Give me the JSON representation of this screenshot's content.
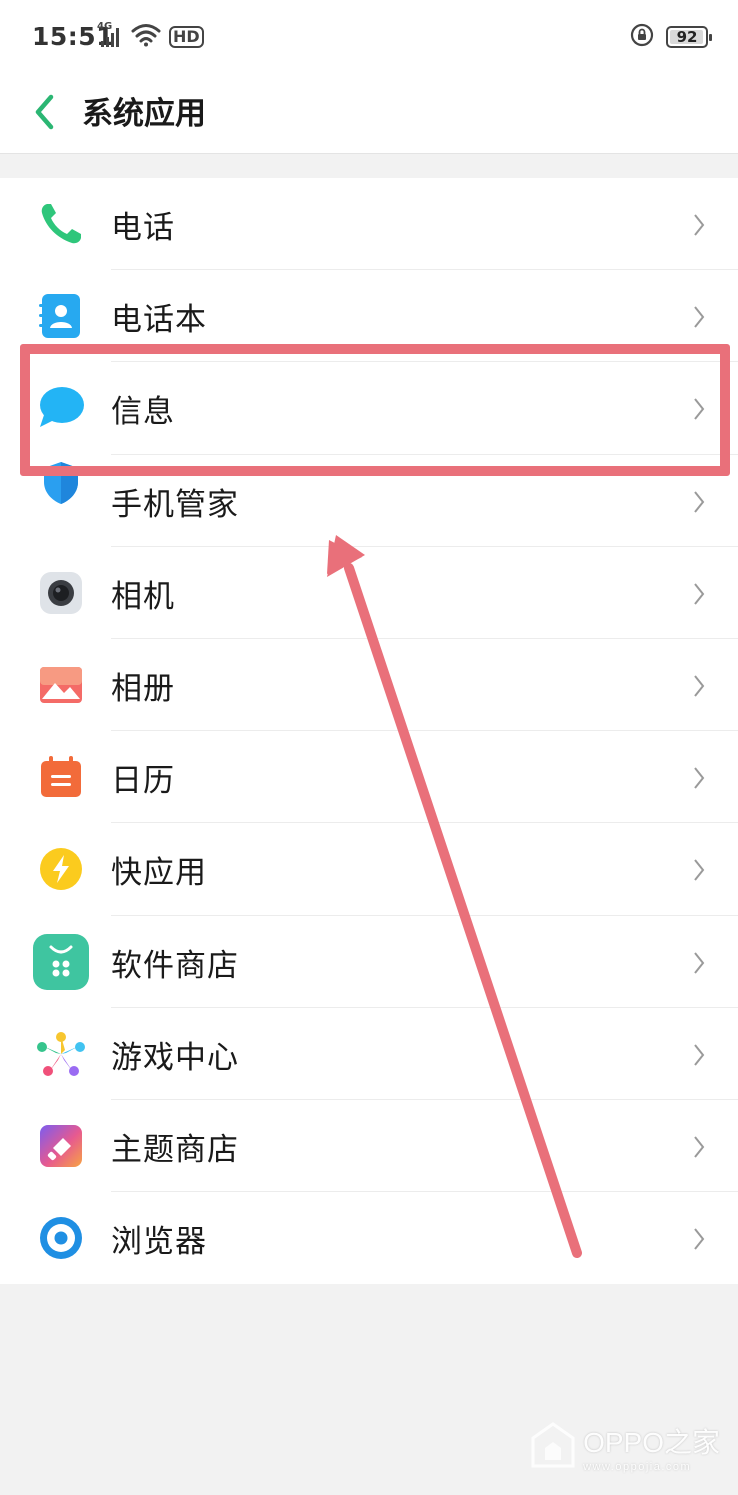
{
  "status_bar": {
    "time": "15:51",
    "network": "4G",
    "hd": "HD",
    "battery_level": "92",
    "icons": [
      "signal-icon",
      "wifi-icon",
      "hd-icon",
      "rotation-lock-icon",
      "battery-icon"
    ]
  },
  "header": {
    "title": "系统应用",
    "back_icon": "back-chevron-icon"
  },
  "apps": [
    {
      "label": "电话",
      "icon": "phone-icon"
    },
    {
      "label": "电话本",
      "icon": "contacts-icon"
    },
    {
      "label": "信息",
      "icon": "messages-icon"
    },
    {
      "label": "手机管家",
      "icon": "phone-manager-icon"
    },
    {
      "label": "相机",
      "icon": "camera-icon"
    },
    {
      "label": "相册",
      "icon": "gallery-icon"
    },
    {
      "label": "日历",
      "icon": "calendar-icon"
    },
    {
      "label": "快应用",
      "icon": "quick-app-icon"
    },
    {
      "label": "软件商店",
      "icon": "app-store-icon"
    },
    {
      "label": "游戏中心",
      "icon": "game-center-icon"
    },
    {
      "label": "主题商店",
      "icon": "theme-store-icon"
    },
    {
      "label": "浏览器",
      "icon": "browser-icon"
    }
  ],
  "annotation": {
    "highlighted_item": "信息",
    "color": "#e9707a"
  },
  "watermark": {
    "title": "OPPO之家",
    "url": "www.oppojia.com"
  },
  "colors": {
    "accent": "#2bb673",
    "background": "#f2f2f2",
    "annotation": "#e9707a"
  }
}
